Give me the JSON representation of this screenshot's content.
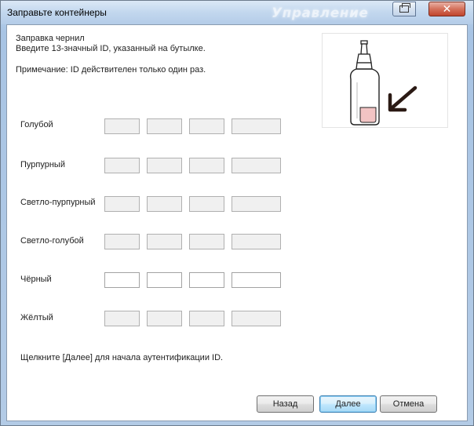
{
  "window": {
    "title": "Заправьте контейнеры",
    "background_title": "Управление"
  },
  "header": {
    "line1": "Заправка чернил",
    "line2": "Введите 13-значный ID, указанный на бутылке.",
    "note": "Примечание: ID действителен только один раз."
  },
  "rows": [
    {
      "label": "Голубой",
      "enabled": false,
      "fields": [
        "",
        "",
        "",
        ""
      ]
    },
    {
      "label": "Пурпурный",
      "enabled": false,
      "fields": [
        "",
        "",
        "",
        ""
      ]
    },
    {
      "label": "Светло-пурпурный",
      "enabled": false,
      "fields": [
        "",
        "",
        "",
        ""
      ]
    },
    {
      "label": "Светло-голубой",
      "enabled": false,
      "fields": [
        "",
        "",
        "",
        ""
      ]
    },
    {
      "label": "Чёрный",
      "enabled": true,
      "fields": [
        "",
        "",
        "",
        ""
      ]
    },
    {
      "label": "Жёлтый",
      "enabled": false,
      "fields": [
        "",
        "",
        "",
        ""
      ]
    }
  ],
  "hint": "Щелкните [Далее] для начала аутентификации ID.",
  "buttons": {
    "back": "Назад",
    "next": "Далее",
    "cancel": "Отмена"
  },
  "colors": {
    "ink_highlight": "#f2c4c4",
    "arrow": "#2b1a14",
    "default_button_border": "#3c7fb1"
  },
  "icons": {
    "restore": "restore-icon",
    "close": "close-icon",
    "illustration": "ink-bottle-illustration"
  }
}
